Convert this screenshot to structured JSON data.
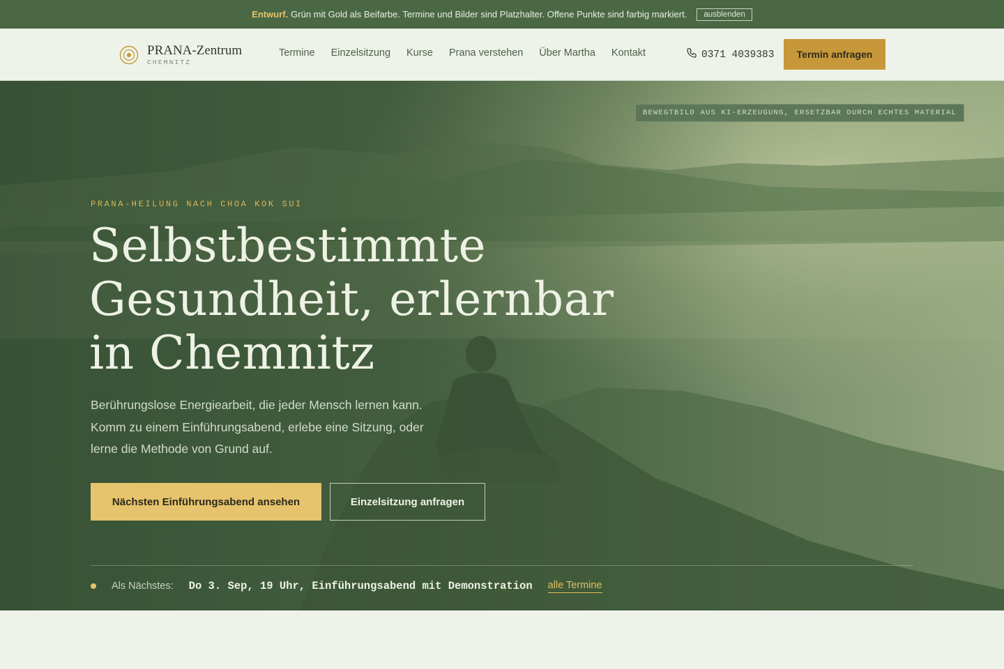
{
  "draft_banner": {
    "label": "Entwurf.",
    "text": "Grün mit Gold als Beifarbe. Termine und Bilder sind Platzhalter. Offene Punkte sind farbig markiert.",
    "hide_button": "ausblenden"
  },
  "header": {
    "logo_name": "PRANA-Zentrum",
    "logo_city": "CHEMNITZ",
    "nav": [
      "Termine",
      "Einzelsitzung",
      "Kurse",
      "Prana verstehen",
      "Über Martha",
      "Kontakt"
    ],
    "phone": "0371 4039383",
    "cta": "Termin anfragen"
  },
  "hero": {
    "image_note": "BEWEGTBILD AUS KI-ERZEUGUNG, ERSETZBAR DURCH ECHTES MATERIAL",
    "eyebrow": "PRANA-HEILUNG NACH CHOA KOK SUI",
    "title_lines": [
      "Selbstbestimmte",
      "Gesundheit, erlernbar",
      "in Chemnitz"
    ],
    "lead": "Berührungslose Energiearbeit, die jeder Mensch lernen kann. Komm zu einem Einführungsabend, erlebe eine Sitzung, oder lerne die Methode von Grund auf.",
    "primary_button": "Nächsten Einführungsabend ansehen",
    "secondary_button": "Einzelsitzung anfragen",
    "next_label": "Als Nächstes:",
    "next_value": "Do 3. Sep, 19 Uhr, Einführungsabend mit Demonstration",
    "next_link": "alle Termine"
  },
  "colors": {
    "brand_green": "#4b6845",
    "gold": "#c7983a",
    "light_gold": "#e6c36c",
    "page_bg": "#eef3ea"
  },
  "icons": [
    "logo-rings-icon",
    "phone-icon",
    "status-dot-icon"
  ]
}
